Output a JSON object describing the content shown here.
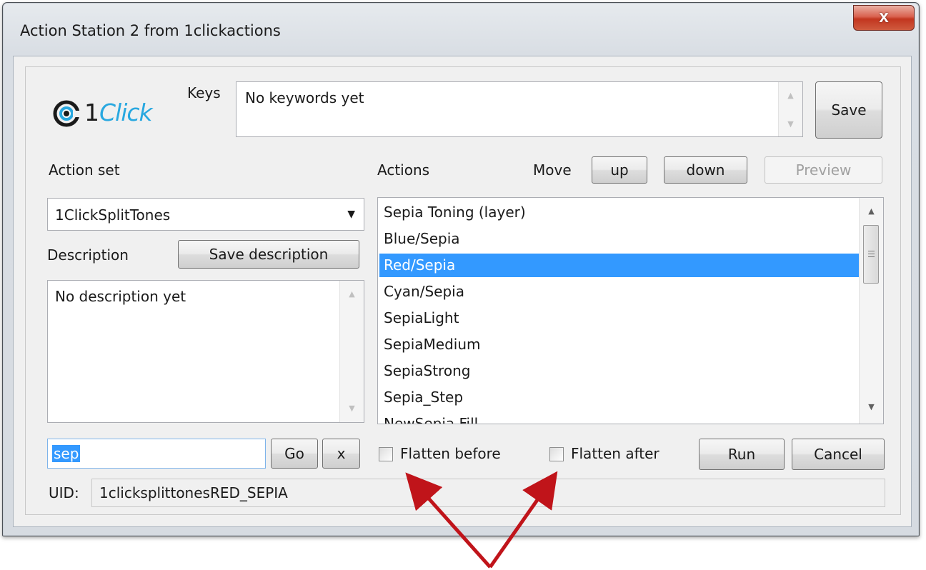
{
  "window": {
    "title": "Action Station 2 from 1clickactions",
    "close_label": "x"
  },
  "logo": {
    "prefix": "1",
    "word": "Click"
  },
  "keys": {
    "label": "Keys",
    "value": "No keywords yet",
    "save_label": "Save"
  },
  "action_set": {
    "label": "Action set",
    "selected": "1ClickSplitTones"
  },
  "description": {
    "label": "Description",
    "save_label": "Save description",
    "value": "No description yet"
  },
  "actions": {
    "label": "Actions",
    "move_label": "Move",
    "up_label": "up",
    "down_label": "down",
    "preview_label": "Preview",
    "selected_index": 2,
    "items": [
      "Sepia Toning (layer)",
      "Blue/Sepia",
      "Red/Sepia",
      "Cyan/Sepia",
      "SepiaLight",
      "SepiaMedium",
      "SepiaStrong",
      "Sepia_Step",
      "NewSepia Fill"
    ]
  },
  "search": {
    "value": "sep",
    "go_label": "Go",
    "clear_label": "x"
  },
  "options": {
    "flatten_before_label": "Flatten before",
    "flatten_after_label": "Flatten after"
  },
  "footer": {
    "run_label": "Run",
    "cancel_label": "Cancel",
    "uid_label": "UID:",
    "uid_value": "1clicksplittonesRED_SEPIA"
  },
  "colors": {
    "selection": "#3399ff",
    "close_button": "#c7442a",
    "annotation_arrow": "#c0141a",
    "logo_accent": "#29a8e0"
  }
}
